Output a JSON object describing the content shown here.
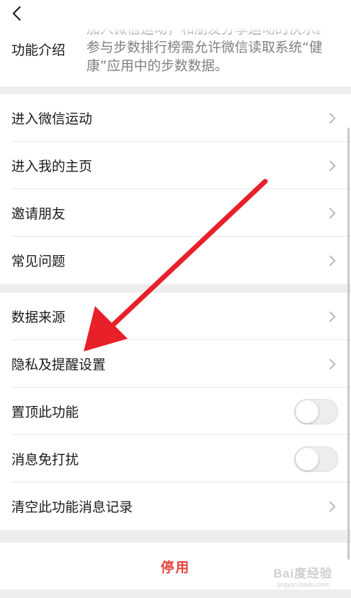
{
  "intro": {
    "label": "功能介绍",
    "text": "加入微信运动，和朋友分享运动的快乐。参与步数排行榜需允许微信读取系统“健康”应用中的步数数据。"
  },
  "group1": [
    {
      "label": "进入微信运动"
    },
    {
      "label": "进入我的主页"
    },
    {
      "label": "邀请朋友"
    },
    {
      "label": "常见问题"
    }
  ],
  "group2": [
    {
      "label": "数据来源"
    },
    {
      "label": "隐私及提醒设置"
    },
    {
      "label": "置顶此功能",
      "toggle": false
    },
    {
      "label": "消息免打扰",
      "toggle": false
    },
    {
      "label": "清空此功能消息记录"
    }
  ],
  "disable_label": "停用",
  "watermark": {
    "main": "Bai度经验",
    "sub": "jingyan.baidu.com"
  },
  "icons": {
    "back": "back-chevron-icon",
    "row_arrow": "chevron-right-icon",
    "annotation": "red-arrow-icon"
  },
  "colors": {
    "danger": "#e64340",
    "annotation_arrow": "#e8202a",
    "background": "#ededed"
  }
}
